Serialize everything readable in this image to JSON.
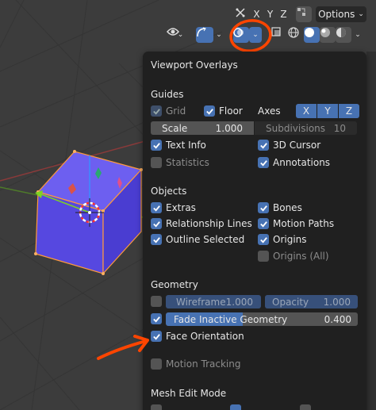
{
  "header": {
    "axes": [
      "X",
      "Y",
      "Z"
    ],
    "options_label": "Options",
    "icons": [
      "gizmo-icon",
      "show-gizmo-icon",
      "overlays-icon",
      "xray-icon",
      "wireframe-shading-icon",
      "solid-shading-icon",
      "material-shading-icon",
      "rendered-shading-icon"
    ]
  },
  "panel": {
    "title": "Viewport Overlays",
    "guides": {
      "heading": "Guides",
      "grid": "Grid",
      "floor": "Floor",
      "axes_label": "Axes",
      "axes": [
        "X",
        "Y",
        "Z"
      ],
      "scale_label": "Scale",
      "scale_value": "1.000",
      "subdivisions_label": "Subdivisions",
      "subdivisions_value": "10",
      "text_info": "Text Info",
      "cursor": "3D Cursor",
      "statistics": "Statistics",
      "annotations": "Annotations"
    },
    "objects": {
      "heading": "Objects",
      "extras": "Extras",
      "bones": "Bones",
      "relationship_lines": "Relationship Lines",
      "motion_paths": "Motion Paths",
      "outline_selected": "Outline Selected",
      "origins": "Origins",
      "origins_all": "Origins (All)"
    },
    "geometry": {
      "heading": "Geometry",
      "wireframe_label": "Wireframe",
      "wireframe_value": "1.000",
      "opacity_label": "Opacity",
      "opacity_value": "1.000",
      "fade_label": "Fade Inactive Geometry",
      "fade_value": "0.400",
      "face_orientation": "Face Orientation",
      "motion_tracking": "Motion Tracking"
    },
    "mesh_edit": {
      "heading": "Mesh Edit Mode"
    }
  },
  "colors": {
    "accent": "#4772b3",
    "panel_bg": "#202020",
    "annotation": "#ff4500",
    "cube_face": "#5a4de6"
  }
}
